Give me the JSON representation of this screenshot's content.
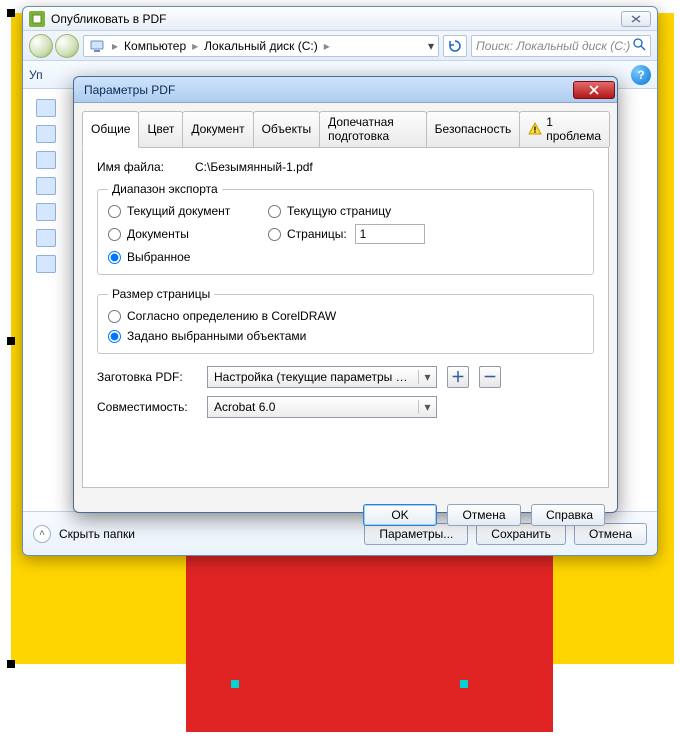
{
  "outer": {
    "title": "Опубликовать в PDF",
    "breadcrumb": {
      "parts": [
        "Компьютер",
        "Локальный диск (C:)"
      ],
      "search_placeholder": "Поиск: Локальный диск (C:)"
    },
    "toolbar": {
      "organize": "Уп"
    },
    "hide_folders": "Скрыть папки",
    "buttons": {
      "params": "Параметры...",
      "save": "Сохранить",
      "cancel": "Отмена"
    }
  },
  "inner": {
    "title": "Параметры PDF",
    "tabs": {
      "general": "Общие",
      "color": "Цвет",
      "document": "Документ",
      "objects": "Объекты",
      "prepress": "Допечатная подготовка",
      "security": "Безопасность",
      "problem": "1 проблема"
    },
    "filename_label": "Имя файла:",
    "filename_value": "C:\\Безымянный-1.pdf",
    "export_range": {
      "legend": "Диапазон экспорта",
      "current_doc": "Текущий документ",
      "documents": "Документы",
      "selection": "Выбранное",
      "current_page": "Текущую страницу",
      "pages_label": "Страницы:",
      "pages_value": "1",
      "selected": "selection"
    },
    "page_size": {
      "legend": "Размер страницы",
      "by_corel": "Согласно определению в CorelDRAW",
      "by_objects": "Задано выбранными объектами",
      "selected": "by_objects"
    },
    "preset_label": "Заготовка PDF:",
    "preset_value": "Настройка (текущие параметры не с...",
    "compat_label": "Совместимость:",
    "compat_value": "Acrobat 6.0",
    "buttons": {
      "ok": "OK",
      "cancel": "Отмена",
      "help": "Справка"
    }
  }
}
